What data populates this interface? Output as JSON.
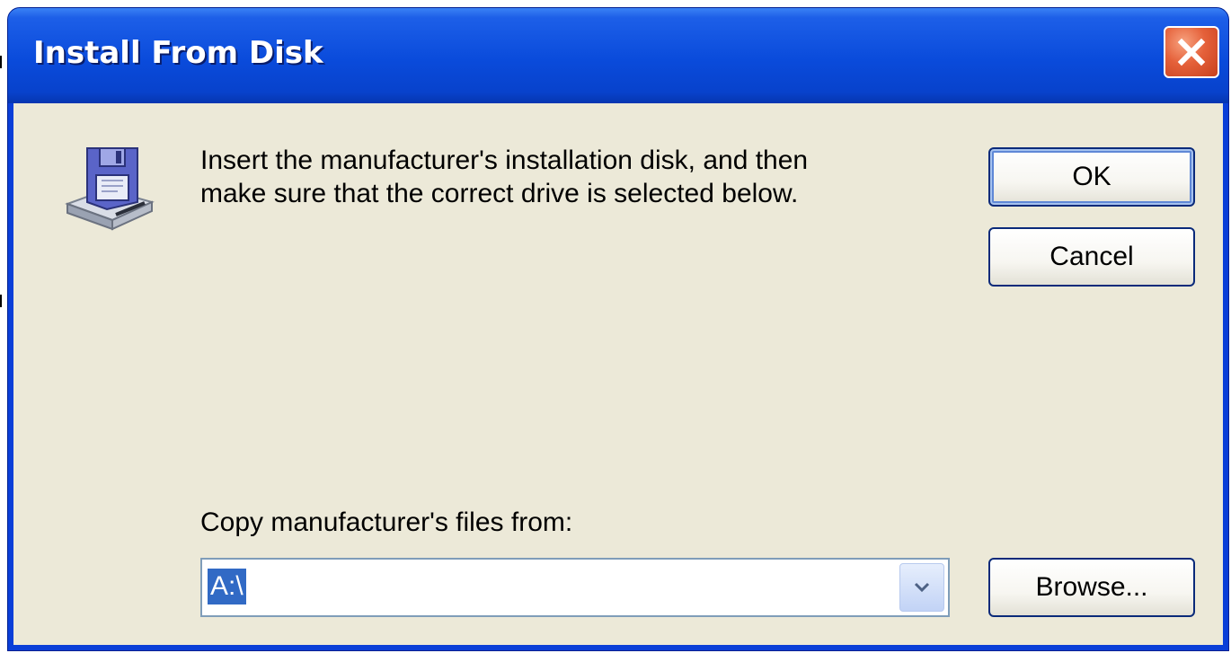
{
  "window": {
    "title": "Install From Disk"
  },
  "titlebar": {
    "close_icon": "close-icon"
  },
  "dialog": {
    "icon": "floppy-disk-drive-icon",
    "instruction_line1": "Insert the manufacturer's installation disk, and then",
    "instruction_line2": "make sure that the correct drive is selected below.",
    "copy_from_label": "Copy manufacturer's files from:",
    "path_value": "A:\\"
  },
  "buttons": {
    "ok_label": "OK",
    "cancel_label": "Cancel",
    "browse_label": "Browse..."
  },
  "colors": {
    "titlebar_blue": "#0a4bdb",
    "dialog_background": "#ece9d8",
    "close_red": "#e5613a",
    "selection_blue": "#316ac5"
  }
}
